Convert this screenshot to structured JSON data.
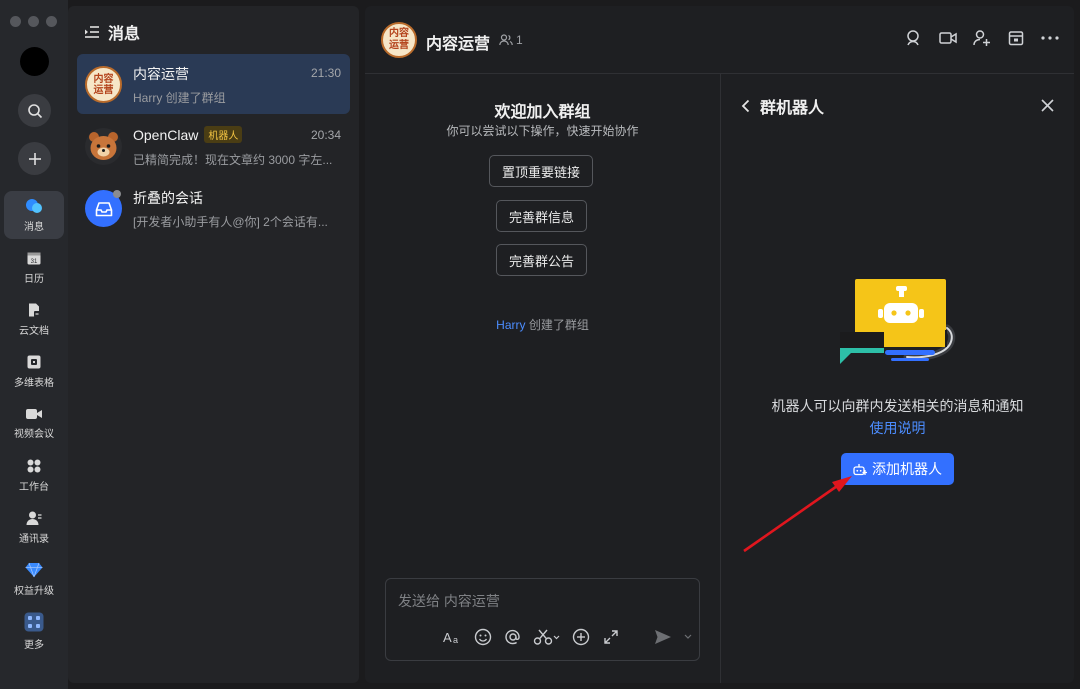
{
  "sidebar": {
    "items": [
      {
        "label": "消息",
        "icon": "message-icon"
      },
      {
        "label": "日历",
        "icon": "calendar-icon"
      },
      {
        "label": "云文档",
        "icon": "document-icon"
      },
      {
        "label": "多维表格",
        "icon": "table-icon"
      },
      {
        "label": "视频会议",
        "icon": "video-icon"
      },
      {
        "label": "工作台",
        "icon": "workspace-icon"
      },
      {
        "label": "通讯录",
        "icon": "contacts-icon"
      },
      {
        "label": "权益升级",
        "icon": "diamond-icon"
      },
      {
        "label": "更多",
        "icon": "more-apps-icon"
      }
    ],
    "calendar_day": "31"
  },
  "list": {
    "title": "消息",
    "conversations": [
      {
        "name": "内容运营",
        "time": "21:30",
        "preview": "Harry 创建了群组",
        "avatar_text": "内容运营"
      },
      {
        "name": "OpenClaw",
        "badge": "机器人",
        "time": "20:34",
        "preview": "已精简完成！现在文章约 3000 字左..."
      },
      {
        "name": "折叠的会话",
        "preview": "[开发者小助手有人@你] 2个会话有..."
      }
    ]
  },
  "chat": {
    "title": "内容运营",
    "avatar_text": "内容运营",
    "member_count": "1",
    "welcome_title": "欢迎加入群组",
    "welcome_sub": "你可以尝试以下操作，快速开始协作",
    "actions": [
      "置顶重要链接",
      "完善群信息",
      "完善群公告"
    ],
    "system_actor": "Harry",
    "system_text": " 创建了群组",
    "composer_placeholder": "发送给 内容运营"
  },
  "bot_panel": {
    "title": "群机器人",
    "description": "机器人可以向群内发送相关的消息和通知",
    "link": "使用说明",
    "add_button": "添加机器人"
  },
  "colors": {
    "accent": "#3370ff",
    "link": "#4c8dff",
    "annotation_arrow": "#e0161e",
    "bot_yellow": "#f5c518",
    "bot_teal": "#2dbfa8"
  }
}
